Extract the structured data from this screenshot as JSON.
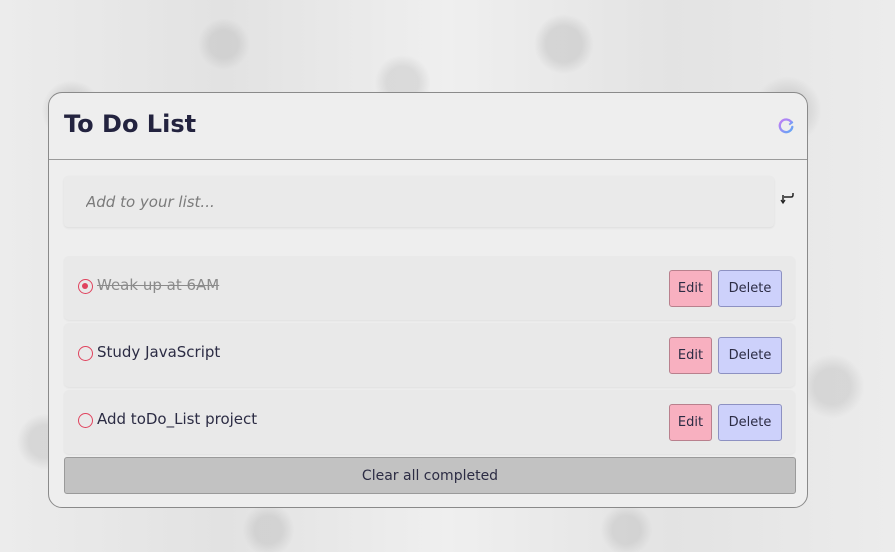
{
  "header": {
    "title": "To Do List"
  },
  "add": {
    "placeholder": "Add to your list..."
  },
  "items": [
    {
      "text": "Weak up at 6AM",
      "completed": true,
      "edit_label": "Edit",
      "delete_label": "Delete"
    },
    {
      "text": "Study JavaScript",
      "completed": false,
      "edit_label": "Edit",
      "delete_label": "Delete"
    },
    {
      "text": "Add toDo_List project",
      "completed": false,
      "edit_label": "Edit",
      "delete_label": "Delete"
    }
  ],
  "footer": {
    "clear_label": "Clear all completed"
  },
  "colors": {
    "accent_pink": "#f8b0c0",
    "accent_lavender": "#cdd1fb",
    "radio": "#e0435e",
    "title": "#23233f"
  },
  "icons": {
    "refresh": "refresh-icon",
    "enter": "enter-arrow-icon"
  }
}
